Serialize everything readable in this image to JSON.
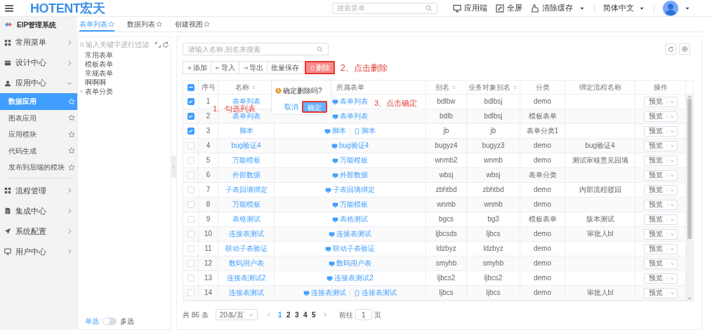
{
  "header": {
    "logo": "HOTENT宏天",
    "search": {
      "placeholder": "搜索菜单"
    },
    "actions": [
      {
        "label": "应用端",
        "kind": "monitor",
        "dropdown": false
      },
      {
        "label": "全屏",
        "kind": "fullscreen",
        "dropdown": false
      },
      {
        "label": "清除缓存",
        "kind": "clean",
        "dropdown": true
      }
    ],
    "language": "简体中文"
  },
  "sidebar": {
    "system": "EIP管理系统",
    "items": [
      {
        "label": "常用菜单",
        "kind": "grid",
        "expanded": false
      },
      {
        "label": "设计中心",
        "kind": "panel",
        "expanded": false
      },
      {
        "label": "应用中心",
        "kind": "user",
        "expanded": true,
        "children": [
          {
            "label": "数据应用",
            "selected": true
          },
          {
            "label": "图表应用",
            "selected": false
          },
          {
            "label": "应用模块",
            "selected": false
          },
          {
            "label": "代码生成",
            "selected": false
          },
          {
            "label": "发布到后端的模块",
            "selected": false
          }
        ]
      },
      {
        "label": "流程管理",
        "kind": "grid",
        "expanded": false
      },
      {
        "label": "集成中心",
        "kind": "doc",
        "expanded": false
      },
      {
        "label": "系统配置",
        "kind": "plane",
        "expanded": false
      },
      {
        "label": "用户中心",
        "kind": "monitor",
        "expanded": false
      }
    ]
  },
  "tabs": [
    {
      "label": "表单列表",
      "selected": true
    },
    {
      "label": "数据列表",
      "selected": false
    },
    {
      "label": "创建视图",
      "selected": false
    }
  ],
  "tree": {
    "placeholder": "输入关键字进行过滤",
    "items": [
      {
        "label": "常用表单",
        "kind": "leaf"
      },
      {
        "label": "模板表单",
        "kind": "leaf"
      },
      {
        "label": "常规表单",
        "kind": "leaf"
      },
      {
        "label": "啊啊啊",
        "kind": "leaf"
      },
      {
        "label": "表单分类",
        "kind": "folder"
      }
    ]
  },
  "selection_mode": {
    "single": "单选",
    "multiple": "多选",
    "multiple_on": false
  },
  "list": {
    "search": {
      "placeholder": "请输入名称,别名来搜索"
    },
    "toolbar": [
      {
        "label": "添加",
        "kind": "add",
        "highlighted": false
      },
      {
        "label": "导入",
        "kind": "import",
        "highlighted": false
      },
      {
        "label": "导出",
        "kind": "export",
        "highlighted": false
      },
      {
        "label": "批量保存",
        "kind": "save",
        "highlighted": false
      },
      {
        "label": "删除",
        "kind": "delete",
        "highlighted": true
      }
    ],
    "popconfirm": {
      "message": "确定删除吗?",
      "cancel": "取消",
      "confirm": "确定",
      "confirm_highlighted": true
    },
    "annotations": [
      {
        "kind": "check",
        "text": "1、勾选列表"
      },
      {
        "kind": "delete",
        "text": "2、点击删除"
      },
      {
        "kind": "confirm",
        "text": "3、点击确定"
      }
    ],
    "table": {
      "select_all": {
        "indeterminate": true
      },
      "columns": [
        {
          "label": "序号",
          "sortable": false
        },
        {
          "label": "名称",
          "sortable": true
        },
        {
          "label": "所属表单",
          "sortable": false
        },
        {
          "label": "别名",
          "sortable": true
        },
        {
          "label": "业务对象别名",
          "sortable": true
        },
        {
          "label": "分类",
          "sortable": false
        },
        {
          "label": "绑定流程名称",
          "sortable": false
        },
        {
          "label": "操作",
          "sortable": false
        }
      ],
      "rows": [
        {
          "checked": true,
          "index": "1",
          "name": "表单列表",
          "forms": [
            {
              "kind": "pc",
              "label": "表单列表"
            }
          ],
          "alias": "bdlbw",
          "bo_alias": "bdlbsj",
          "category": "demo",
          "action": "预览"
        },
        {
          "checked": true,
          "index": "2",
          "name": "表单列表",
          "forms": [
            {
              "kind": "pc",
              "label": "表单列表"
            }
          ],
          "alias": "bdlb",
          "bo_alias": "bdlbsj",
          "category": "模板表单",
          "action": "预览"
        },
        {
          "checked": true,
          "index": "3",
          "name": "脚本",
          "forms": [
            {
              "kind": "pc",
              "label": "脚本"
            },
            {
              "kind": "mobile",
              "label": "脚本"
            }
          ],
          "alias": "jb",
          "bo_alias": "jb",
          "category": "表单分类1",
          "action": "预览"
        },
        {
          "checked": false,
          "index": "4",
          "name": "bug验证4",
          "forms": [
            {
              "kind": "pc",
              "label": "bug验证4"
            }
          ],
          "alias": "bugyz4",
          "bo_alias": "bugyz3",
          "category": "demo",
          "flow": "bug验证4",
          "action": "预览"
        },
        {
          "checked": false,
          "index": "5",
          "name": "万能模板",
          "forms": [
            {
              "kind": "pc",
              "label": "万能模板"
            }
          ],
          "alias": "wnmb2",
          "bo_alias": "wnmb",
          "category": "demo",
          "flow": "测试审核意见回填",
          "action": "预览"
        },
        {
          "checked": false,
          "index": "6",
          "name": "外部数据",
          "forms": [
            {
              "kind": "pc",
              "label": "外部数据"
            }
          ],
          "alias": "wbsj",
          "bo_alias": "wbsj",
          "category": "表单分类",
          "action": "预览"
        },
        {
          "checked": false,
          "index": "7",
          "name": "子表回填绑定",
          "forms": [
            {
              "kind": "pc",
              "label": "子表回填绑定"
            }
          ],
          "alias": "zbhtbd",
          "bo_alias": "zbhtbd",
          "category": "demo",
          "flow": "内部流程驳回",
          "action": "预览"
        },
        {
          "checked": false,
          "index": "8",
          "name": "万能模板",
          "forms": [
            {
              "kind": "pc",
              "label": "万能模板"
            }
          ],
          "alias": "wnmb",
          "bo_alias": "wnmb",
          "category": "demo",
          "action": "预览"
        },
        {
          "checked": false,
          "index": "9",
          "name": "表格测试",
          "forms": [
            {
              "kind": "pc",
              "label": "表格测试"
            }
          ],
          "alias": "bgcs",
          "bo_alias": "bg3",
          "category": "模板表单",
          "flow": "版本测试",
          "action": "预览"
        },
        {
          "checked": false,
          "index": "10",
          "name": "连接表测试",
          "forms": [
            {
              "kind": "pc",
              "label": "连接表测试"
            }
          ],
          "alias": "ljbcsds",
          "bo_alias": "ljbcs",
          "category": "demo",
          "flow": "审批人bl",
          "action": "预览"
        },
        {
          "checked": false,
          "index": "11",
          "name": "联动子表验证",
          "forms": [
            {
              "kind": "pc",
              "label": "联动子表验证"
            }
          ],
          "alias": "ldzbyz",
          "bo_alias": "ldzbyz",
          "category": "demo",
          "action": "预览"
        },
        {
          "checked": false,
          "index": "12",
          "name": "数码用户表",
          "forms": [
            {
              "kind": "pc",
              "label": "数码用户表"
            }
          ],
          "alias": "smyhb",
          "bo_alias": "smyhb",
          "category": "demo",
          "action": "预览"
        },
        {
          "checked": false,
          "index": "13",
          "name": "连接表测试2",
          "forms": [
            {
              "kind": "pc",
              "label": "连接表测试2"
            }
          ],
          "alias": "ljbcs2",
          "bo_alias": "ljbcs2",
          "category": "demo",
          "action": "预览"
        },
        {
          "checked": false,
          "index": "14",
          "name": "连接表测试",
          "forms": [
            {
              "kind": "pc",
              "label": "连接表测试"
            },
            {
              "kind": "mobile",
              "label": "连接表测试"
            }
          ],
          "alias": "ljbcs",
          "bo_alias": "ljbcs",
          "category": "demo",
          "flow": "审批人bl",
          "action": "预览"
        }
      ]
    },
    "pagination": {
      "total": "共 86 条",
      "page_size": "20条/页",
      "pages": [
        {
          "label": "1",
          "selected": true
        },
        {
          "label": "2",
          "selected": false
        },
        {
          "label": "3",
          "selected": false
        },
        {
          "label": "4",
          "selected": false
        },
        {
          "label": "5",
          "selected": false
        }
      ],
      "goto_label": "前往",
      "goto_value": "1",
      "page_unit": "页"
    }
  }
}
